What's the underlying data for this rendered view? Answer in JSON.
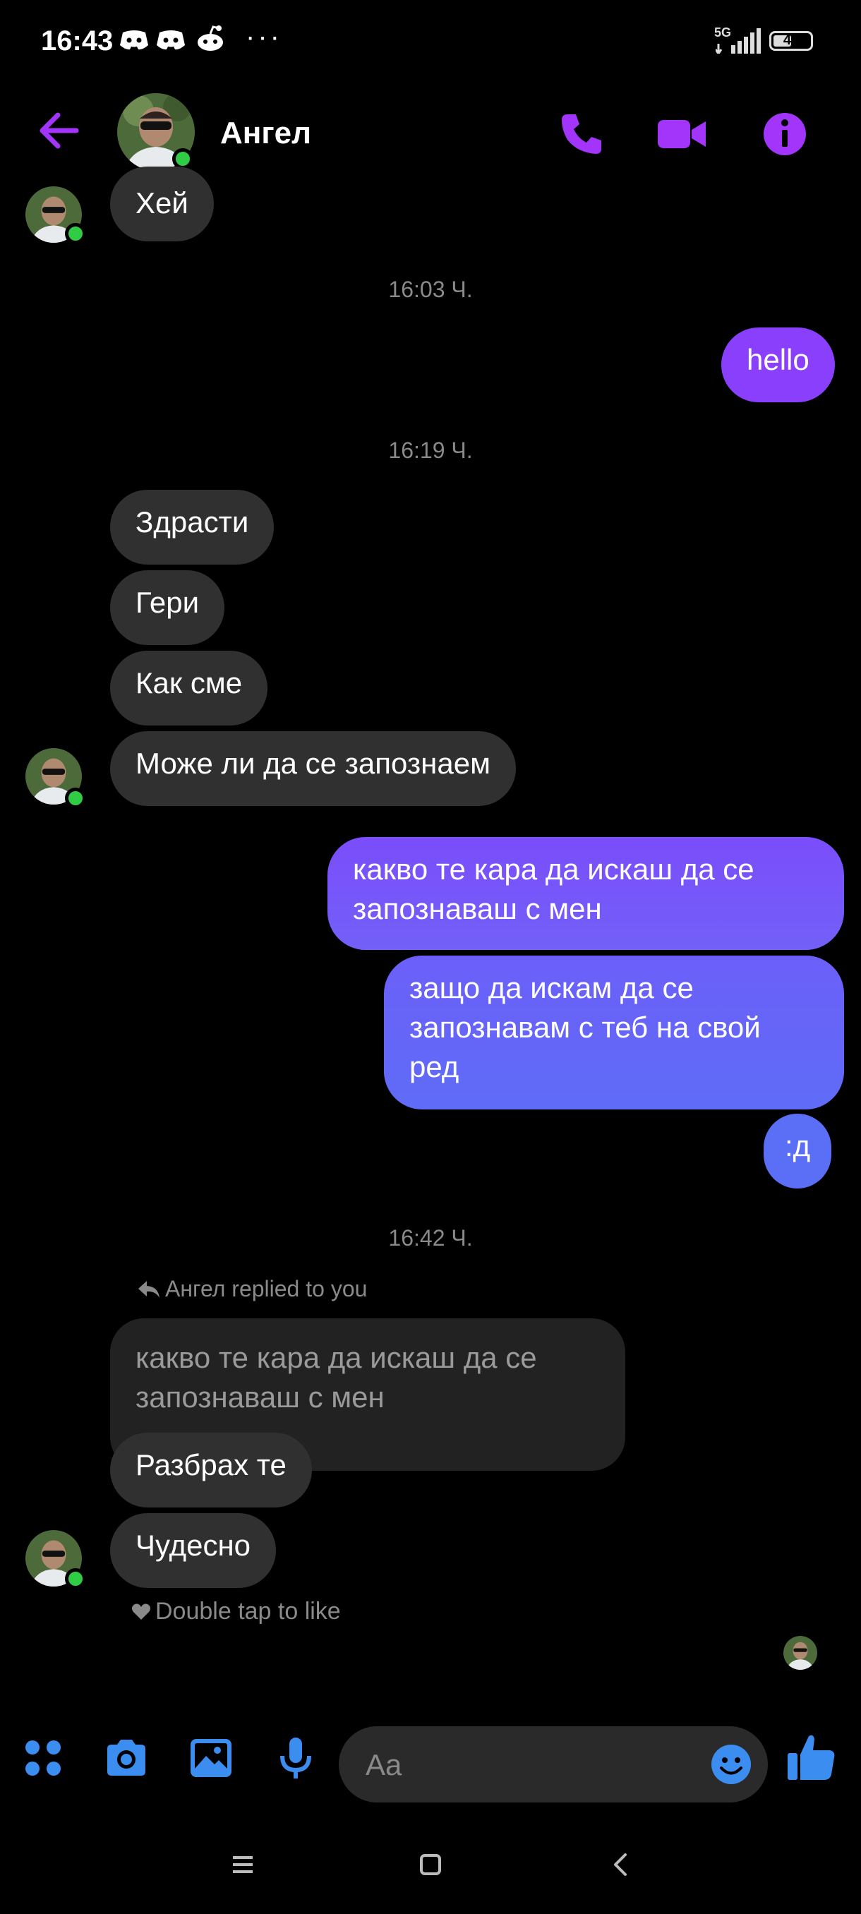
{
  "status_bar": {
    "time": "16:43",
    "network": "5G",
    "battery": "49",
    "battery_level": 0.49,
    "notification_icons": [
      "discord-icon",
      "discord-icon",
      "reddit-icon",
      "more-dots-icon"
    ]
  },
  "header": {
    "contact_name": "Ангел",
    "actions": [
      "back-arrow-icon",
      "phone-icon",
      "video-camera-icon",
      "info-icon"
    ]
  },
  "colors": {
    "accent_purple": "#a334fa",
    "outgoing_start": "#8a3ffc",
    "outgoing_end": "#5f6cf7",
    "incoming": "#303030",
    "online": "#31cc46",
    "composer_blue": "#3b8df0"
  },
  "messages": [
    {
      "id": "m0",
      "dir": "in",
      "text": "Хей"
    },
    {
      "id": "t1",
      "type": "timestamp",
      "text": "16:03 Ч."
    },
    {
      "id": "m1",
      "dir": "out",
      "text": "hello"
    },
    {
      "id": "t2",
      "type": "timestamp",
      "text": "16:19 Ч."
    },
    {
      "id": "m2",
      "dir": "in",
      "text": "Здрасти"
    },
    {
      "id": "m3",
      "dir": "in",
      "text": "Гери"
    },
    {
      "id": "m4",
      "dir": "in",
      "text": "Как сме"
    },
    {
      "id": "m5",
      "dir": "in",
      "text": "Може ли да се запознаем"
    },
    {
      "id": "m6",
      "dir": "out",
      "lines": [
        "какво те кара да искаш да се",
        "запознаваш с мен"
      ]
    },
    {
      "id": "m7",
      "dir": "out",
      "lines": [
        "защо да искам да се",
        "запознавам с теб на свой",
        "ред"
      ]
    },
    {
      "id": "m8",
      "dir": "out",
      "text": ":д"
    },
    {
      "id": "t3",
      "type": "timestamp",
      "text": "16:42 Ч."
    },
    {
      "id": "r1",
      "type": "reply_indicator",
      "text": "Ангел replied to you"
    },
    {
      "id": "q1",
      "type": "quoted",
      "lines": [
        "какво те кара да искаш да се",
        "запознаваш с мен"
      ]
    },
    {
      "id": "m9",
      "dir": "in",
      "text": "Разбрах те"
    },
    {
      "id": "m10",
      "dir": "in",
      "text": "Чудесно"
    }
  ],
  "double_tap_hint": "Double tap to like",
  "composer": {
    "placeholder": "Aa",
    "value": "",
    "actions": [
      "apps-grid-icon",
      "camera-icon",
      "gallery-icon",
      "microphone-icon",
      "emoji-icon",
      "thumbs-up-icon"
    ]
  },
  "nav_bar": {
    "buttons": [
      "menu-icon",
      "home-icon",
      "back-icon"
    ]
  }
}
